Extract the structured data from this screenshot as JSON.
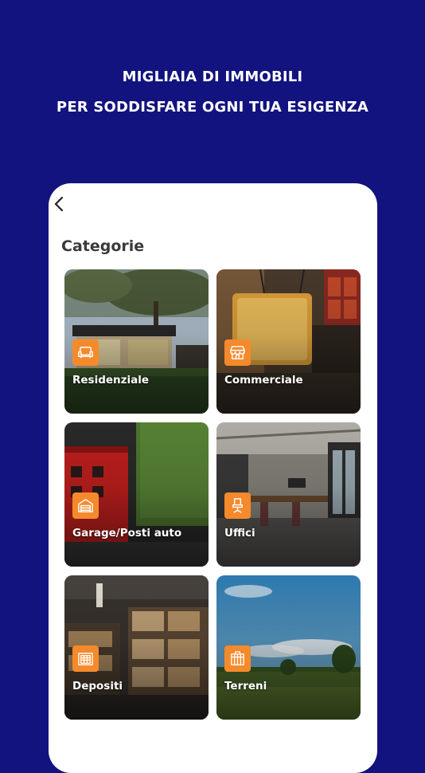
{
  "headline": {
    "line1": "MIGLIAIA DI IMMOBILI",
    "line2": "PER SODDISFARE OGNI TUA ESIGENZA"
  },
  "screen": {
    "back_icon": "chevron-left-icon",
    "section_title": "Categorie",
    "categories": [
      {
        "label": "Residenziale",
        "icon": "armchair-icon"
      },
      {
        "label": "Commerciale",
        "icon": "storefront-icon"
      },
      {
        "label": "Garage/Posti auto",
        "icon": "garage-icon"
      },
      {
        "label": "Uffici",
        "icon": "office-chair-icon"
      },
      {
        "label": "Depositi",
        "icon": "warehouse-icon"
      },
      {
        "label": "Terreni",
        "icon": "field-icon"
      }
    ]
  },
  "colors": {
    "background": "#12137e",
    "accent": "#f58a2c",
    "card_text": "#ffffff",
    "title_text": "#3a3a3a"
  }
}
